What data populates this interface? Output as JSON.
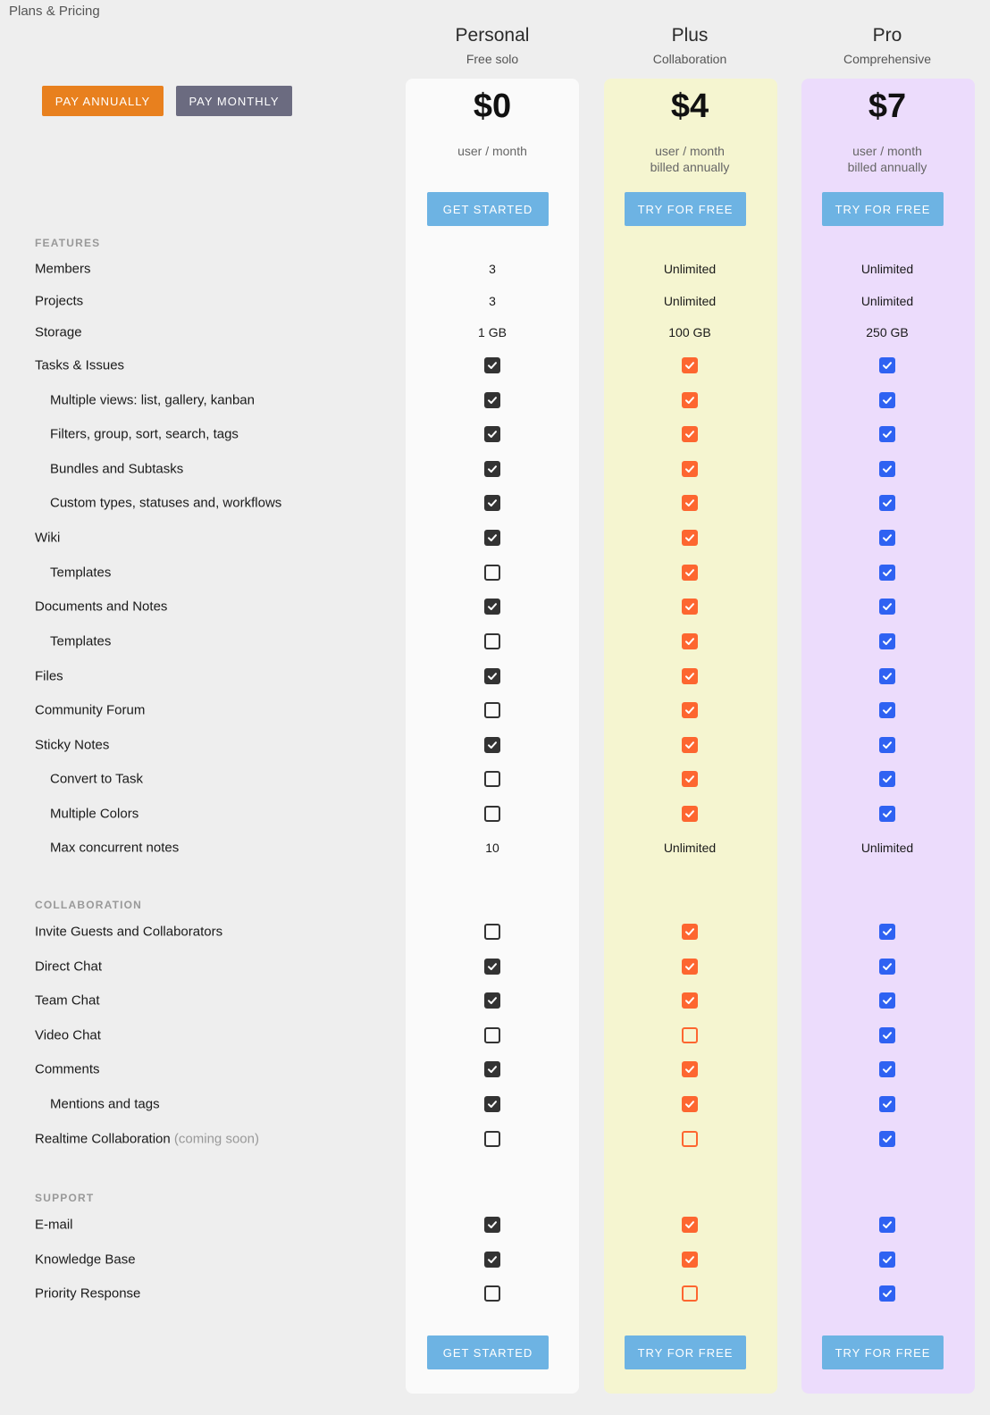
{
  "page_title": "Plans & Pricing",
  "billing_toggle": {
    "annual_label": "PAY ANNUALLY",
    "monthly_label": "PAY MONTHLY",
    "selected": "annual"
  },
  "colors": {
    "annual_button": "#e8801e",
    "monthly_button": "#6b6b80",
    "cta_button": "#6db3e3",
    "personal_check": "#333333",
    "plus_check": "#fd6630",
    "pro_check": "#2f62f2"
  },
  "plans": [
    {
      "id": "personal",
      "name": "Personal",
      "subtitle": "Free solo",
      "price": "$0",
      "price_unit": "user / month",
      "billing_note": "",
      "cta_label": "GET STARTED",
      "background": "#fafafa"
    },
    {
      "id": "plus",
      "name": "Plus",
      "subtitle": "Collaboration",
      "price": "$4",
      "price_unit": "user / month",
      "billing_note": "billed annually",
      "cta_label": "TRY FOR FREE",
      "background": "#f5f5d0"
    },
    {
      "id": "pro",
      "name": "Pro",
      "subtitle": "Comprehensive",
      "price": "$7",
      "price_unit": "user / month",
      "billing_note": "billed annually",
      "cta_label": "TRY FOR FREE",
      "background": "#ecdcfc"
    }
  ],
  "sections": [
    {
      "title": "FEATURES",
      "rows": [
        {
          "label": "Members",
          "level": 0,
          "values": [
            "3",
            "Unlimited",
            "Unlimited"
          ]
        },
        {
          "label": "Projects",
          "level": 0,
          "values": [
            "3",
            "Unlimited",
            "Unlimited"
          ]
        },
        {
          "label": "Storage",
          "level": 0,
          "values": [
            "1 GB",
            "100 GB",
            "250 GB"
          ]
        },
        {
          "label": "Tasks & Issues",
          "level": 0,
          "values": [
            true,
            true,
            true
          ]
        },
        {
          "label": "Multiple views: list, gallery, kanban",
          "level": 1,
          "values": [
            true,
            true,
            true
          ]
        },
        {
          "label": "Filters, group, sort, search, tags",
          "level": 1,
          "values": [
            true,
            true,
            true
          ]
        },
        {
          "label": "Bundles and Subtasks",
          "level": 1,
          "values": [
            true,
            true,
            true
          ]
        },
        {
          "label": "Custom types, statuses and, workflows",
          "level": 1,
          "values": [
            true,
            true,
            true
          ]
        },
        {
          "label": "Wiki",
          "level": 0,
          "values": [
            true,
            true,
            true
          ]
        },
        {
          "label": "Templates",
          "level": 1,
          "values": [
            false,
            true,
            true
          ]
        },
        {
          "label": "Documents and Notes",
          "level": 0,
          "values": [
            true,
            true,
            true
          ]
        },
        {
          "label": "Templates",
          "level": 1,
          "values": [
            false,
            true,
            true
          ]
        },
        {
          "label": "Files",
          "level": 0,
          "values": [
            true,
            true,
            true
          ]
        },
        {
          "label": "Community Forum",
          "level": 0,
          "values": [
            false,
            true,
            true
          ]
        },
        {
          "label": "Sticky Notes",
          "level": 0,
          "values": [
            true,
            true,
            true
          ]
        },
        {
          "label": "Convert to Task",
          "level": 1,
          "values": [
            false,
            true,
            true
          ]
        },
        {
          "label": "Multiple Colors",
          "level": 1,
          "values": [
            false,
            true,
            true
          ]
        },
        {
          "label": "Max concurrent notes",
          "level": 1,
          "values": [
            "10",
            "Unlimited",
            "Unlimited"
          ]
        }
      ]
    },
    {
      "title": "COLLABORATION",
      "rows": [
        {
          "label": "Invite Guests and Collaborators",
          "level": 0,
          "values": [
            false,
            true,
            true
          ]
        },
        {
          "label": "Direct Chat",
          "level": 0,
          "values": [
            true,
            true,
            true
          ]
        },
        {
          "label": "Team Chat",
          "level": 0,
          "values": [
            true,
            true,
            true
          ]
        },
        {
          "label": "Video Chat",
          "level": 0,
          "values": [
            false,
            false,
            true
          ]
        },
        {
          "label": "Comments",
          "level": 0,
          "values": [
            true,
            true,
            true
          ]
        },
        {
          "label": "Mentions and tags",
          "level": 1,
          "values": [
            true,
            true,
            true
          ]
        },
        {
          "label": "Realtime Collaboration",
          "note": "(coming soon)",
          "level": 0,
          "values": [
            false,
            false,
            true
          ]
        }
      ]
    },
    {
      "title": "SUPPORT",
      "rows": [
        {
          "label": "E-mail",
          "level": 0,
          "values": [
            true,
            true,
            true
          ]
        },
        {
          "label": "Knowledge Base",
          "level": 0,
          "values": [
            true,
            true,
            true
          ]
        },
        {
          "label": "Priority Response",
          "level": 0,
          "values": [
            false,
            false,
            true
          ]
        }
      ]
    }
  ]
}
